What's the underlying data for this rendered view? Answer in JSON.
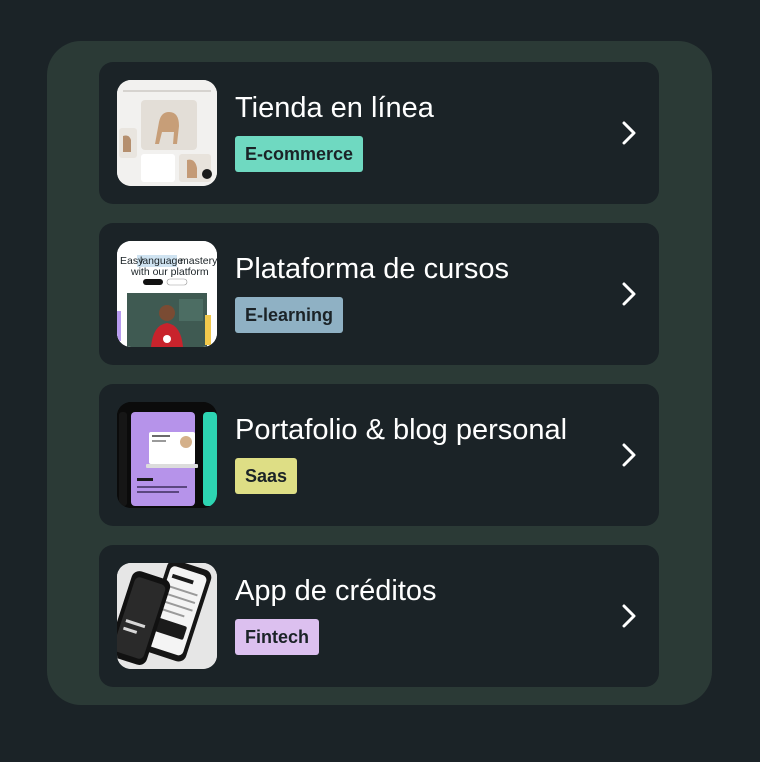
{
  "items": [
    {
      "title": "Tienda en línea",
      "tag": "E-commerce",
      "tag_color": "#6fd9c1",
      "icon": "ecommerce-thumbnail"
    },
    {
      "title": "Plataforma de cursos",
      "tag": "E-learning",
      "tag_color": "#8fb1c4",
      "icon": "elearning-thumbnail",
      "thumb_text": {
        "line1a": "Easy",
        "highlight": "language",
        "line1b": "mastery",
        "line2": "with our platform"
      }
    },
    {
      "title": "Portafolio & blog personal",
      "tag": "Saas",
      "tag_color": "#dede85",
      "icon": "portfolio-thumbnail"
    },
    {
      "title": "App de créditos",
      "tag": "Fintech",
      "tag_color": "#dcc0ef",
      "icon": "fintech-thumbnail"
    }
  ]
}
